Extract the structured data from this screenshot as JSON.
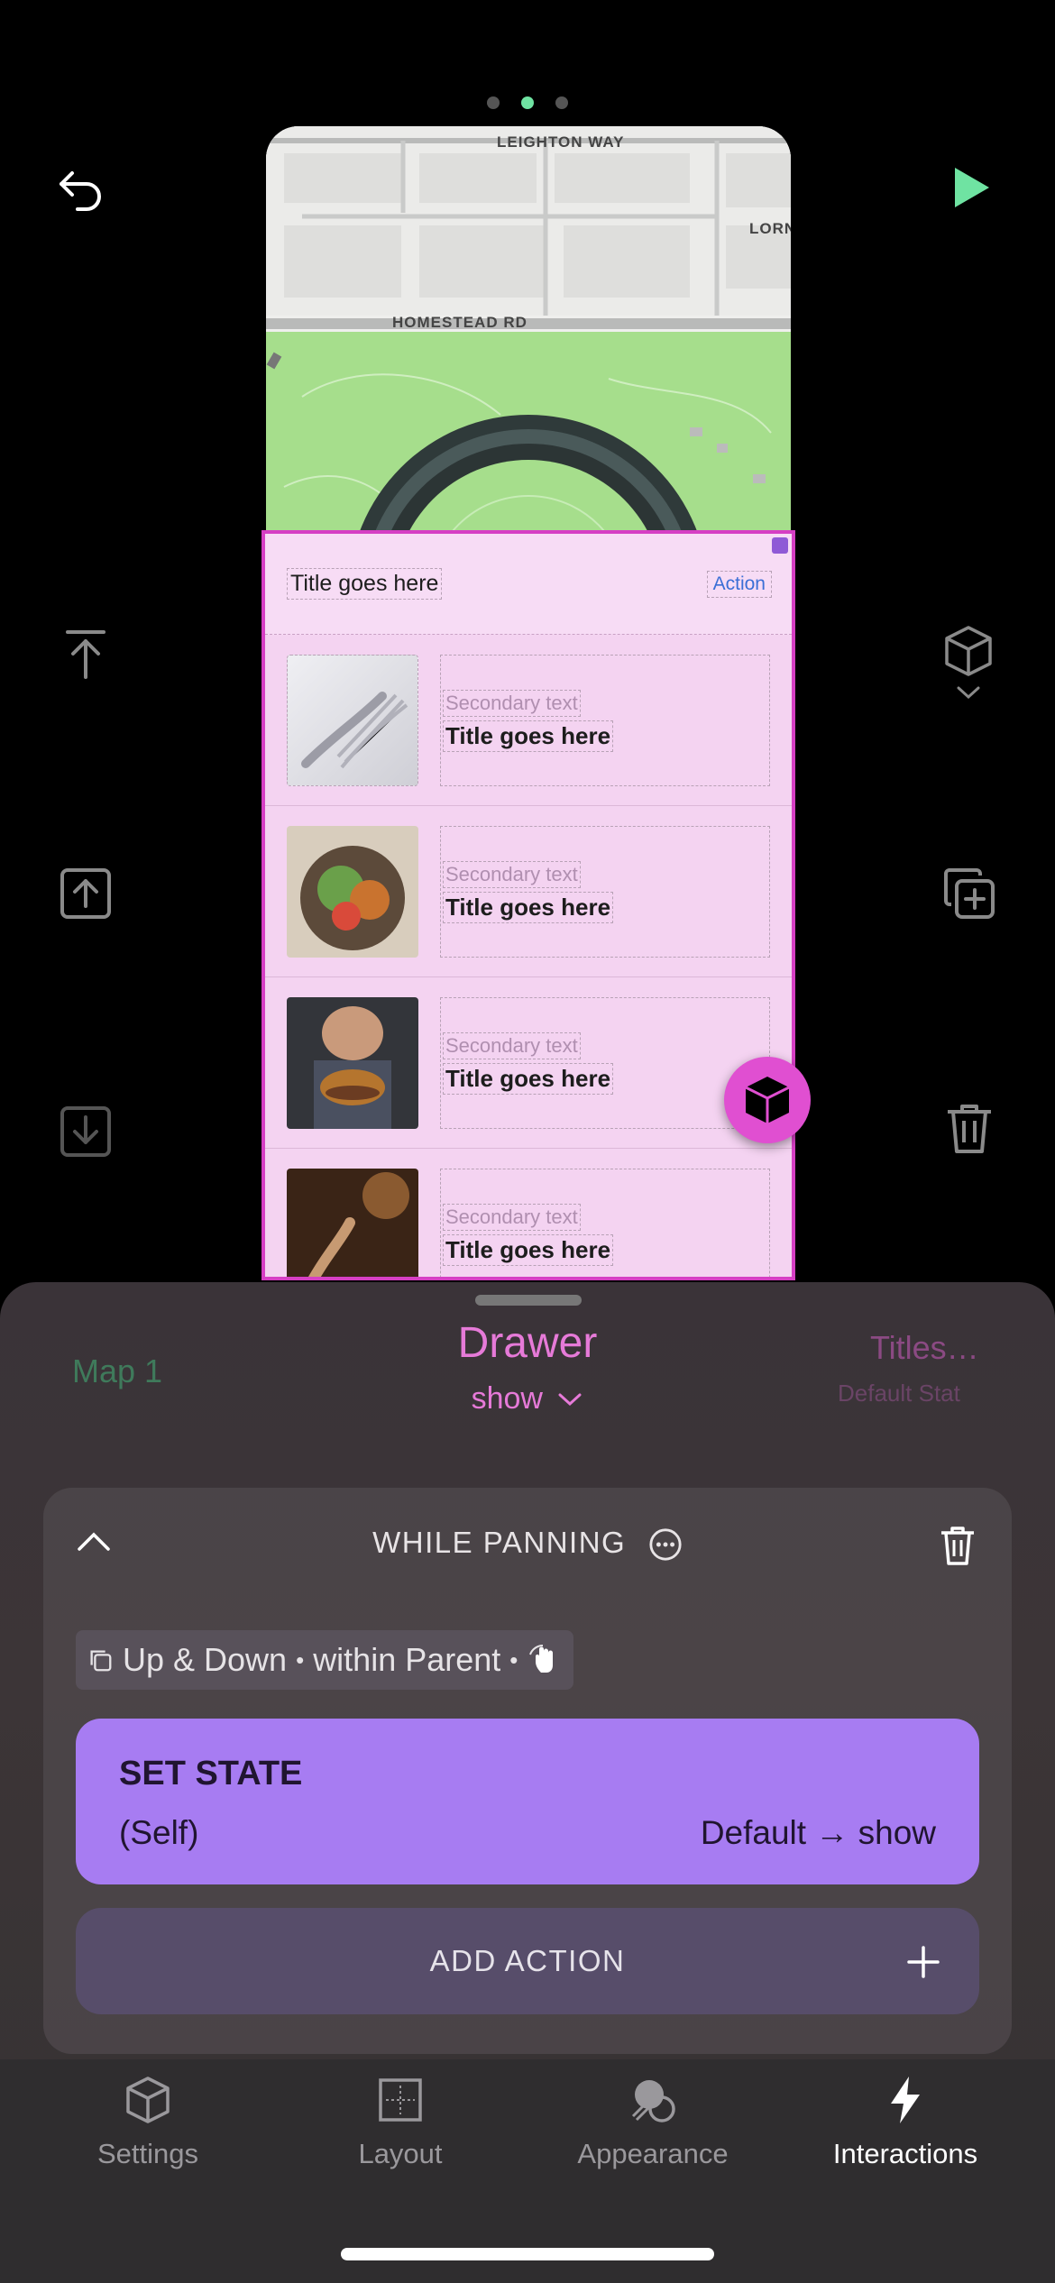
{
  "pager": {
    "count": 3,
    "active_index": 1
  },
  "colors": {
    "accent_green": "#6fe3a2",
    "drawer_pink": "#e67ad8",
    "set_state_purple": "#a77cf2"
  },
  "top_bar": {
    "undo_icon": "undo-icon",
    "play_icon": "play-icon"
  },
  "left_tools": [
    "align-top-icon",
    "move-up-icon",
    "move-down-icon"
  ],
  "right_tools": [
    "component-icon",
    "duplicate-icon",
    "trash-icon"
  ],
  "map": {
    "street_1": "LEIGHTON WAY",
    "street_2": "HOMESTEAD RD",
    "street_3": "LORN"
  },
  "drawer": {
    "header_title": "Title goes here",
    "header_action": "Action",
    "rows": [
      {
        "secondary": "Secondary text",
        "title": "Title goes here"
      },
      {
        "secondary": "Secondary text",
        "title": "Title goes here"
      },
      {
        "secondary": "Secondary text",
        "title": "Title goes here"
      },
      {
        "secondary": "Secondary text",
        "title": "Title goes here"
      }
    ]
  },
  "layers": {
    "prev": "Map 1",
    "current": "Drawer",
    "current_state": "show",
    "next": "Titles…",
    "next_state": "Default Stat"
  },
  "interaction": {
    "trigger": "WHILE PANNING",
    "gesture": {
      "direction": "Up & Down",
      "sep": "•",
      "constraint": "within Parent"
    },
    "action": {
      "title": "SET STATE",
      "target": "(Self)",
      "transition": "Default → show"
    },
    "add_action": "ADD ACTION"
  },
  "tabs": [
    {
      "label": "Settings",
      "icon": "cube-icon",
      "active": false
    },
    {
      "label": "Layout",
      "icon": "layout-grid-icon",
      "active": false
    },
    {
      "label": "Appearance",
      "icon": "appearance-icon",
      "active": false
    },
    {
      "label": "Interactions",
      "icon": "lightning-icon",
      "active": true
    }
  ]
}
